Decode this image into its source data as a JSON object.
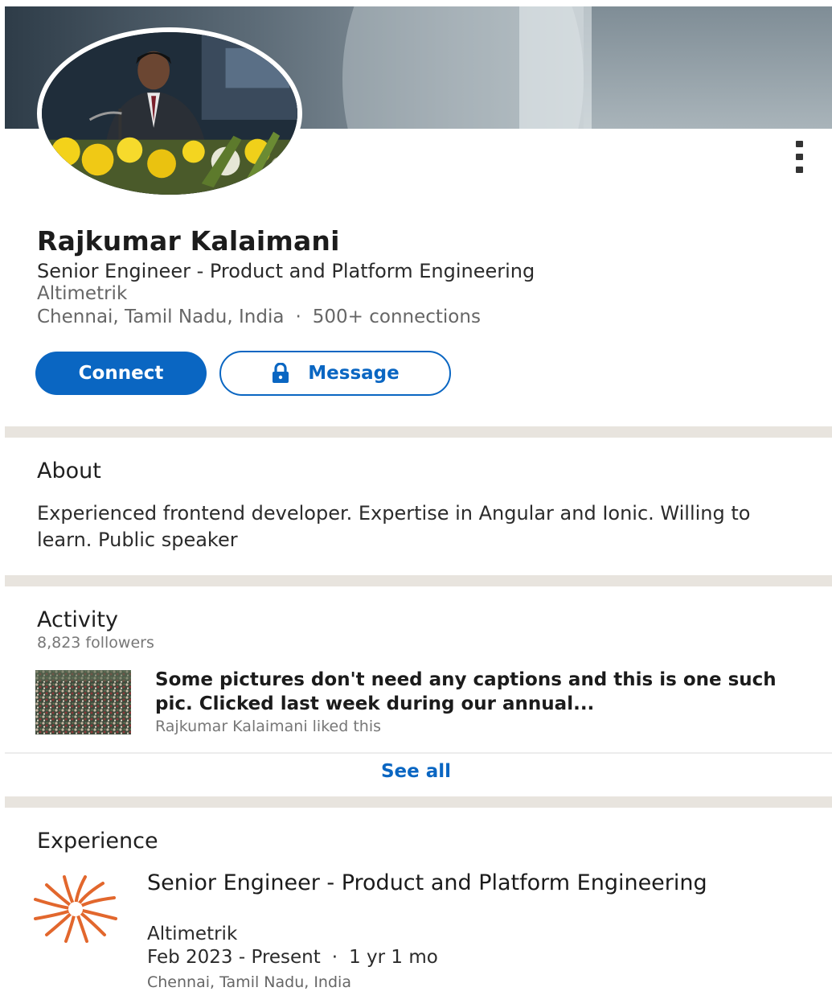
{
  "profile": {
    "name": "Rajkumar Kalaimani",
    "headline": "Senior Engineer - Product and Platform Engineering",
    "company": "Altimetrik",
    "location": "Chennai, Tamil Nadu, India",
    "separator": "·",
    "connections": "500+ connections"
  },
  "actions": {
    "connect_label": "Connect",
    "message_label": "Message",
    "more_icon": "more-vertical-icon",
    "lock_icon": "lock-icon"
  },
  "about": {
    "title": "About",
    "text": "Experienced frontend developer. Expertise in Angular and Ionic. Willing to learn. Public speaker"
  },
  "activity": {
    "title": "Activity",
    "followers": "8,823 followers",
    "post": {
      "text": "Some pictures don't need any captions and this is one such pic. Clicked last week during our annual...",
      "meta": "Rajkumar Kalaimani liked this"
    },
    "see_all_label": "See all"
  },
  "experience": {
    "title": "Experience",
    "items": [
      {
        "title": "Senior Engineer - Product and Platform Engineering",
        "company": "Altimetrik",
        "dates": "Feb 2023 - Present",
        "separator": "·",
        "duration": "1 yr 1 mo",
        "location": "Chennai, Tamil Nadu, India"
      }
    ]
  },
  "colors": {
    "accent": "#0a66c2",
    "divider": "#e8e4de",
    "logo": "#e2672d"
  }
}
